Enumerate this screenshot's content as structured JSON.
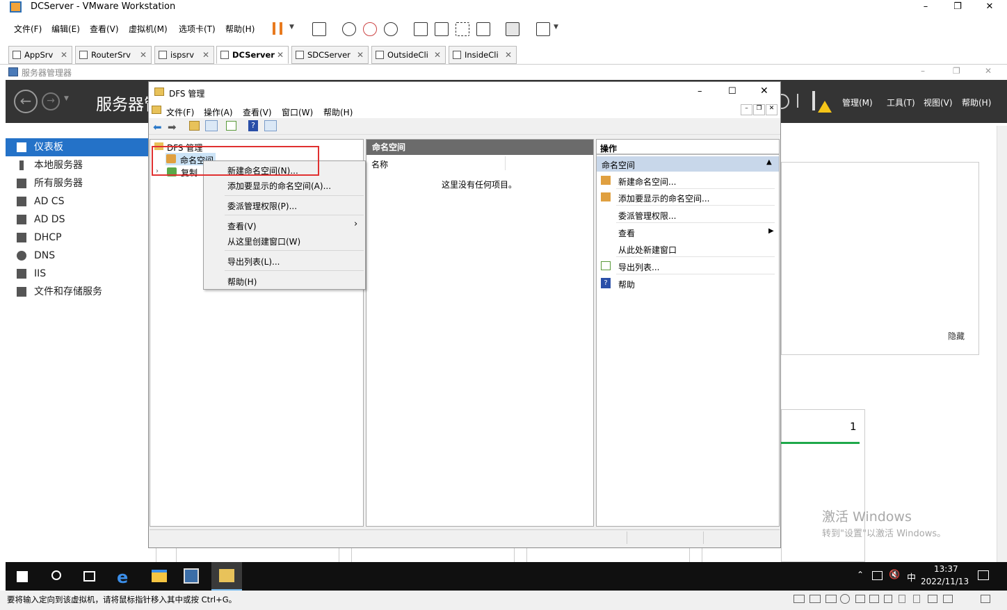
{
  "vmware": {
    "title": "DCServer - VMware Workstation",
    "menu": [
      "文件(F)",
      "编辑(E)",
      "查看(V)",
      "虚拟机(M)",
      "选项卡(T)",
      "帮助(H)"
    ],
    "tabs": [
      {
        "label": "AppSrv"
      },
      {
        "label": "RouterSrv"
      },
      {
        "label": "ispsrv"
      },
      {
        "label": "DCServer"
      },
      {
        "label": "SDCServer"
      },
      {
        "label": "OutsideCli"
      },
      {
        "label": "InsideCli"
      }
    ],
    "status_text": "要将输入定向到该虚拟机，请将鼠标指针移入其中或按 Ctrl+G。"
  },
  "server_manager": {
    "window_title": "服务器管理器",
    "header_title": "服务器管",
    "header_menu": [
      "管理(M)",
      "工具(T)",
      "视图(V)",
      "帮助(H)"
    ],
    "sidebar": [
      {
        "label": "仪表板"
      },
      {
        "label": "本地服务器"
      },
      {
        "label": "所有服务器"
      },
      {
        "label": "AD CS"
      },
      {
        "label": "AD DS"
      },
      {
        "label": "DHCP"
      },
      {
        "label": "DNS"
      },
      {
        "label": "IIS"
      },
      {
        "label": "文件和存储服务"
      }
    ],
    "hide_label": "隐藏",
    "tile_count": "1",
    "watermark_line1": "激活 Windows",
    "watermark_line2": "转到\"设置\"以激活 Windows。"
  },
  "dfs": {
    "title": "DFS 管理",
    "menu": [
      "文件(F)",
      "操作(A)",
      "查看(V)",
      "窗口(W)",
      "帮助(H)"
    ],
    "tree": {
      "root": "DFS 管理",
      "namespaces": "命名空间",
      "replication": "复制"
    },
    "middle_header": "命名空间",
    "column_name": "名称",
    "empty_text": "这里没有任何项目。",
    "actions_header": "操作",
    "actions_section": "命名空间",
    "actions": {
      "new_namespace": "新建命名空间...",
      "add_display": "添加要显示的命名空间...",
      "delegate": "委派管理权限...",
      "view": "查看",
      "new_window": "从此处新建窗口",
      "export": "导出列表...",
      "help": "帮助"
    },
    "context_menu": {
      "new_namespace": "新建命名空间(N)...",
      "add_display": "添加要显示的命名空间(A)...",
      "delegate": "委派管理权限(P)...",
      "view": "查看(V)",
      "new_window": "从这里创建窗口(W)",
      "export": "导出列表(L)...",
      "help": "帮助(H)"
    }
  },
  "taskbar": {
    "time": "13:37",
    "date": "2022/11/13",
    "ime": "中"
  },
  "colors": {
    "highlight_red": "#e03030",
    "selection_blue": "#2472c8",
    "header_dark": "#343434"
  }
}
